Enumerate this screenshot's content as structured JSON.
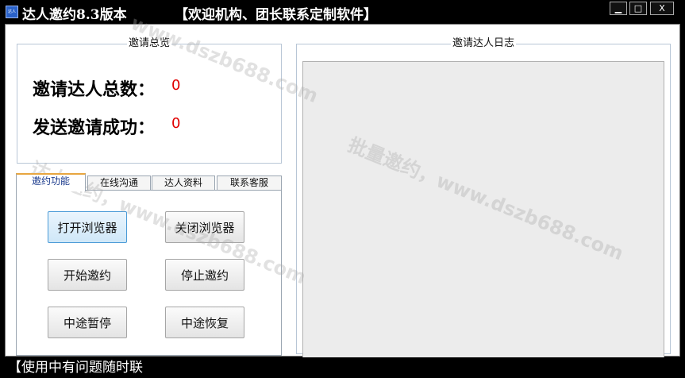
{
  "window": {
    "icon_text": "达人",
    "title": "达人邀约8.3版本",
    "banner": "【欢迎机构、团长联系定制软件】",
    "minimize_glyph": "▁",
    "maximize_glyph": "□",
    "close_glyph": "X"
  },
  "summary": {
    "group_title": "邀请总览",
    "invited_total_label": "邀请达人总数：",
    "invited_total_value": "0",
    "invite_success_label": "发送邀请成功：",
    "invite_success_value": "0"
  },
  "tabs": [
    {
      "label": "邀约功能",
      "active": true
    },
    {
      "label": "在线沟通",
      "active": false
    },
    {
      "label": "达人资料",
      "active": false
    },
    {
      "label": "联系客服",
      "active": false
    }
  ],
  "buttons": {
    "open_browser": "打开浏览器",
    "close_browser": "关闭浏览器",
    "start_invite": "开始邀约",
    "stop_invite": "停止邀约",
    "pause": "中途暂停",
    "resume": "中途恢复"
  },
  "log": {
    "group_title": "邀请达人日志"
  },
  "status_bar": {
    "text": "【使用中有问题随时联"
  },
  "watermarks": {
    "w1": "www.dszb688.com",
    "w2": "批量邀约，www.dszb688.com",
    "w3": "达人邀约，www.dszb688.com"
  },
  "colors": {
    "stat_value": "#e00000",
    "active_tab_top": "#e8a640",
    "window_chrome": "#000000"
  }
}
